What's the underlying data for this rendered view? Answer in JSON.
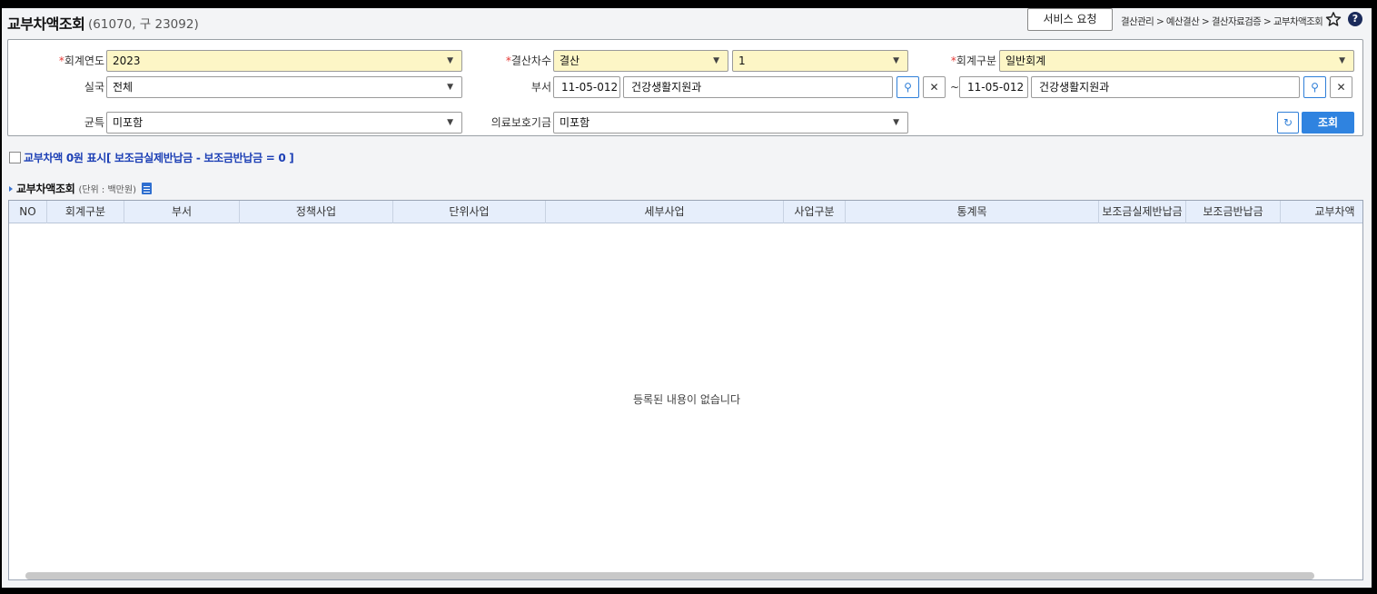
{
  "header": {
    "title": "교부차액조회",
    "code": "(61070, 구 23092)",
    "service_button": "서비스 요청",
    "breadcrumb": "결산관리 > 예산결산 > 결산자료검증 > 교부차액조회",
    "star_icon": "star-outline-icon",
    "help_icon": "question-circle-icon",
    "help_glyph": "?"
  },
  "search": {
    "req_mark": "*",
    "fiscal_year_label": "회계연도",
    "fiscal_year_value": "2023",
    "settle_round_label": "결산차수",
    "settle_round_type": "결산",
    "settle_round_no": "1",
    "account_type_label": "회계구분",
    "account_type_value": "일반회계",
    "office_label": "실국",
    "office_value": "전체",
    "dept_label": "부서",
    "dept_from_code": "11-05-012",
    "dept_from_name": "건강생활지원과",
    "tilde": "~",
    "dept_to_code": "11-05-012",
    "dept_to_name": "건강생활지원과",
    "county_label": "균특",
    "county_value": "미포함",
    "medical_fund_label": "의료보호기금",
    "medical_fund_value": "미포함",
    "reset_icon": "refresh-icon",
    "query_button": "조회",
    "search_glyph": "⚲",
    "clear_glyph": "✕",
    "reset_glyph": "↻",
    "dropdown_glyph": "▼"
  },
  "options": {
    "zero_diff_checkbox_label": "교부차액 0원 표시[ 보조금실제반납금 - 보조금반납금 = 0 ]",
    "zero_diff_checked": false
  },
  "section": {
    "title": "교부차액조회",
    "unit": "(단위 : 백만원)",
    "excel_icon": "excel-download-icon"
  },
  "grid": {
    "columns": [
      "NO",
      "회계구분",
      "부서",
      "정책사업",
      "단위사업",
      "세부사업",
      "사업구분",
      "통계목",
      "보조금실제반납금",
      "보조금반납금",
      "교부차액"
    ],
    "rows": [],
    "empty_message": "등록된 내용이 없습니다"
  }
}
